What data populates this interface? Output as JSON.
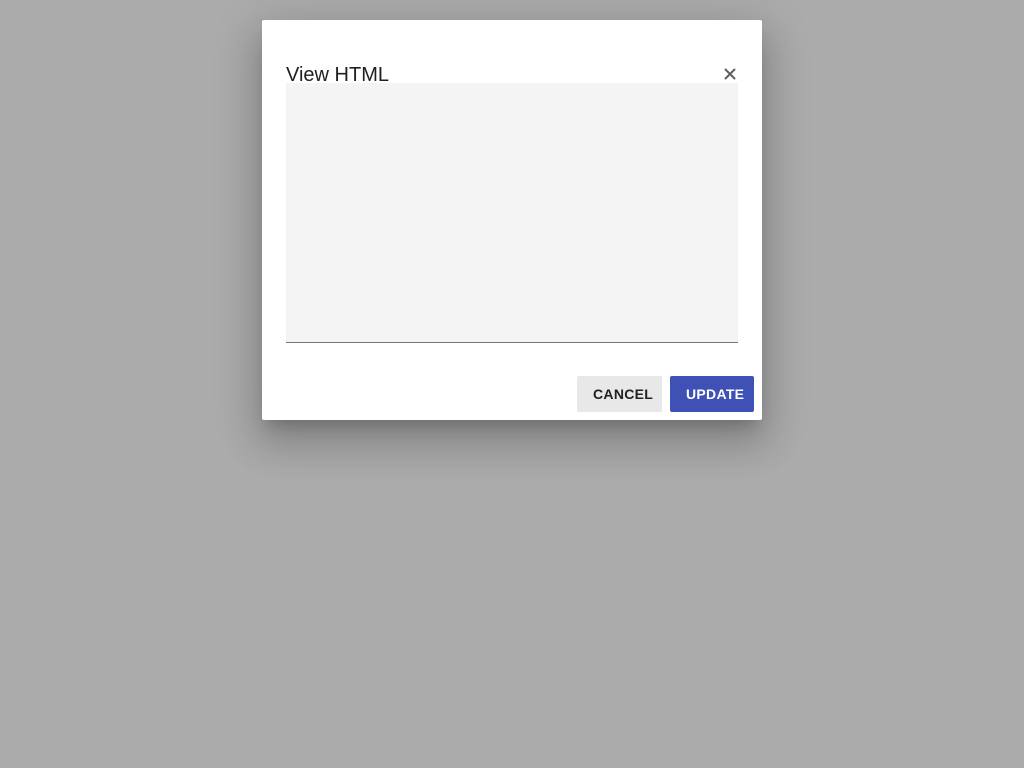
{
  "dialog": {
    "title": "View HTML",
    "close_icon": "close-icon",
    "textarea_value": "",
    "buttons": {
      "cancel_label": "CANCEL",
      "update_label": "UPDATE"
    }
  },
  "colors": {
    "backdrop": "#ababab",
    "dialog_bg": "#ffffff",
    "textarea_bg": "#f4f4f4",
    "primary": "#3f51b5",
    "secondary_button": "#e8e8e8"
  }
}
